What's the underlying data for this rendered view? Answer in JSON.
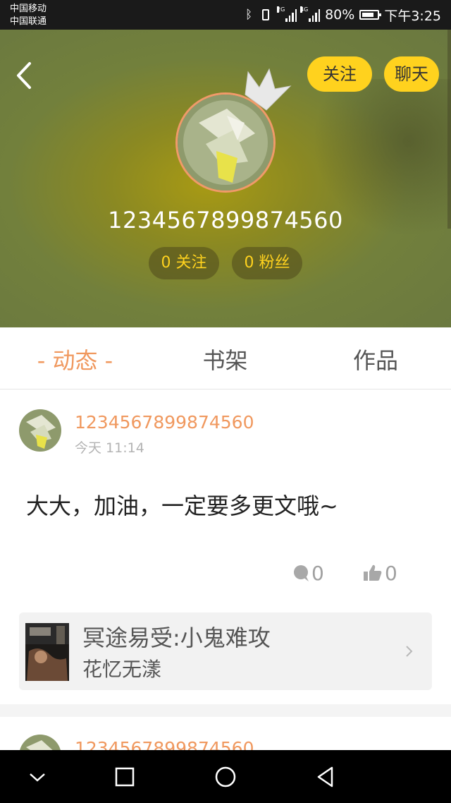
{
  "status_bar": {
    "carrier_1": "中国移动",
    "carrier_2": "中国联通",
    "network_1": "2G",
    "network_2": "4G",
    "battery": "80%",
    "time": "下午3:25"
  },
  "header": {
    "back_icon": "chevron-left-icon",
    "follow_label": "关注",
    "chat_label": "聊天",
    "username": "1234567899874560",
    "following_count": "0 关注",
    "followers_count": "0 粉丝"
  },
  "tabs": [
    {
      "label": "- 动态 -",
      "active": true
    },
    {
      "label": "书架",
      "active": false
    },
    {
      "label": "作品",
      "active": false
    }
  ],
  "feed": [
    {
      "author": "1234567899874560",
      "time": "今天 11:14",
      "text": "大大，加油，一定要多更文哦~",
      "comments": "0",
      "likes": "0",
      "book": {
        "title": "冥途易受:小鬼难攻",
        "author": "花忆无漾"
      }
    },
    {
      "author": "1234567899874560"
    }
  ],
  "colors": {
    "accent": "#f0985e",
    "button_yellow": "#ffd21e",
    "header_olive": "#7c8534"
  },
  "nav_bar": {
    "icons": [
      "chevron-down-icon",
      "square-icon",
      "circle-icon",
      "triangle-back-icon"
    ]
  }
}
